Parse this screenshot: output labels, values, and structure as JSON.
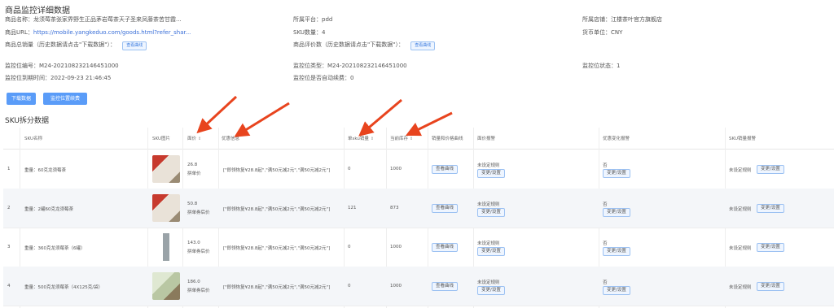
{
  "page_title": "商品监控详细数据",
  "info": {
    "goods_name_label": "商品名称：",
    "goods_name": "龙须莓茶张家界野生正品茅岩莓茶天子圣来凤藤茶苦甘霞...",
    "platform_label": "所属平台：",
    "platform": "pdd",
    "store_label": "所属店铺：",
    "store": "江楼茶叶官方旗舰店",
    "url_label": "商品URL：",
    "url": "https://mobile.yangkeduo.com/goods.html?refer_shar...",
    "sku_count_label": "SKU数量：",
    "sku_count": "4",
    "currency_label": "货币单位：",
    "currency": "CNY",
    "total_sales_label": "商品总销量（历史数据请点击\"下载数据\"）：",
    "total_sales_button": "查看曲线",
    "reviews_label": "商品评价数（历史数据请点击\"下载数据\"）：",
    "reviews_button": "查看曲线",
    "monitor_id_label": "监控位编号：",
    "monitor_id": "M24-202108232146451000",
    "monitor_type_label": "监控位类型：",
    "monitor_type": "M24-202108232146451000",
    "monitor_status_label": "监控位状态：",
    "monitor_status": "1",
    "expire_label": "监控位到期时间：",
    "expire": "2022-09-23 21:46:45",
    "auto_renew_label": "监控位是否自动续费：",
    "auto_renew": "0"
  },
  "buttons": {
    "download": "下载数据",
    "renew": "监控位置续费"
  },
  "section_title": "SKU拆分数据",
  "table": {
    "headers": {
      "sku_name": "SKU名称",
      "sku_image": "SKU图片",
      "price": "面价",
      "promo": "优惠信息",
      "sales": "单sku销量",
      "stock": "当前库存",
      "curve": "销量和价格曲线",
      "price_alert": "面价报警",
      "promo_alert": "优惠变化报警",
      "sales_alert": "SKU销量报警"
    },
    "sort_icon": "⇕",
    "rows": [
      {
        "index": "1",
        "name": "重量：60克龙须莓茶",
        "price": "26.8",
        "price_note": "拼单价",
        "promo": "[\"即领恢复¥28.8起\",\"满50元减2元\",\"满50元减2元\"]",
        "sales": "0",
        "stock": "1000",
        "curve_btn": "查看曲线",
        "price_alert": "未设定规则",
        "price_alert_btn": "变更/设置",
        "promo_alert": "否",
        "promo_alert_btn": "变更/设置",
        "sales_alert": "未设定规则",
        "sales_alert_btn": "变更/设置"
      },
      {
        "index": "2",
        "name": "重量：2罐60克龙须莓茶",
        "price": "50.8",
        "price_note": "拼单券后价",
        "promo": "[\"即领恢复¥28.8起\",\"满50元减2元\",\"满50元减2元\"]",
        "sales": "121",
        "stock": "873",
        "curve_btn": "查看曲线",
        "price_alert": "未设定规则",
        "price_alert_btn": "变更/设置",
        "promo_alert": "否",
        "promo_alert_btn": "变更/设置",
        "sales_alert": "未设定规则",
        "sales_alert_btn": "变更/设置"
      },
      {
        "index": "3",
        "name": "重量：360克龙须莓茶（6罐）",
        "price": "143.0",
        "price_note": "拼单券后价",
        "promo": "[\"即领恢复¥28.8起\",\"满50元减2元\",\"满50元减2元\"]",
        "sales": "0",
        "stock": "1000",
        "curve_btn": "查看曲线",
        "price_alert": "未设定规则",
        "price_alert_btn": "变更/设置",
        "promo_alert": "否",
        "promo_alert_btn": "变更/设置",
        "sales_alert": "未设定规则",
        "sales_alert_btn": "变更/设置"
      },
      {
        "index": "4",
        "name": "重量：500克龙须莓茶（4X125克/袋）",
        "price": "186.0",
        "price_note": "拼单券后价",
        "promo": "[\"即领恢复¥28.8起\",\"满50元减2元\",\"满50元减2元\"]",
        "sales": "0",
        "stock": "1000",
        "curve_btn": "查看曲线",
        "price_alert": "未设定规则",
        "price_alert_btn": "变更/设置",
        "promo_alert": "否",
        "promo_alert_btn": "变更/设置",
        "sales_alert": "未设定规则",
        "sales_alert_btn": "变更/设置"
      }
    ]
  },
  "colors": {
    "accent": "#5a9cf8",
    "link": "#3a6fd8",
    "arrow": "#e8441e"
  }
}
